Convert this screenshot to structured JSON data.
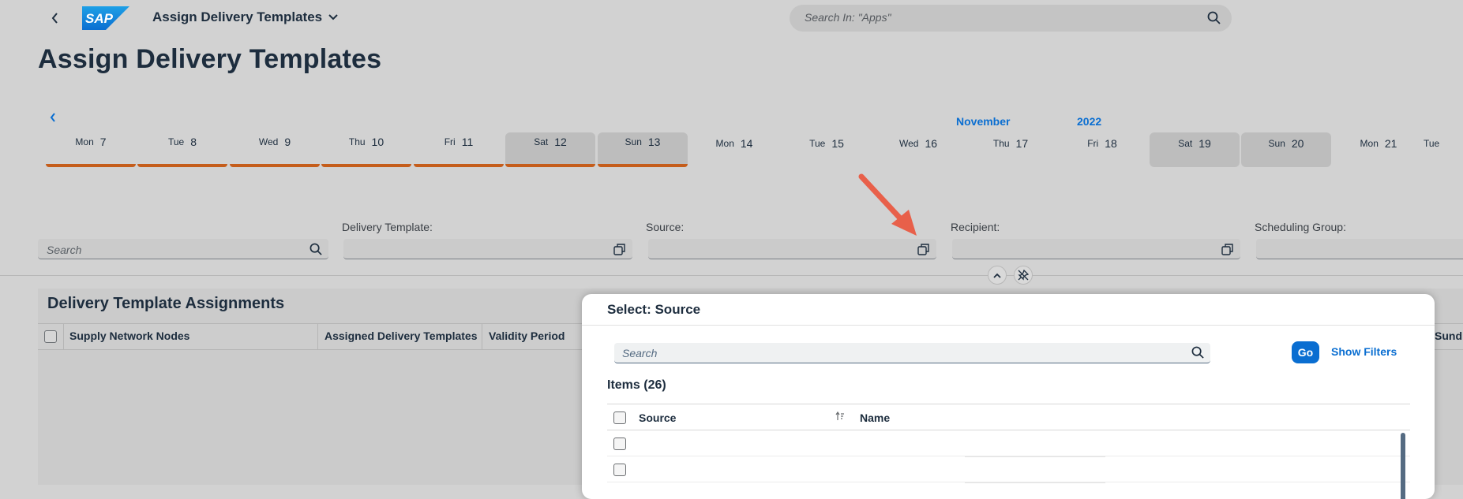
{
  "shell": {
    "app_title": "Assign Delivery Templates",
    "search_placeholder": "Search In: \"Apps\"",
    "logo_text": "SAP"
  },
  "page_title": "Assign Delivery Templates",
  "calendar": {
    "month": "November",
    "year": "2022",
    "days": [
      {
        "name": "Mon",
        "num": "7"
      },
      {
        "name": "Tue",
        "num": "8"
      },
      {
        "name": "Wed",
        "num": "9"
      },
      {
        "name": "Thu",
        "num": "10"
      },
      {
        "name": "Fri",
        "num": "11"
      },
      {
        "name": "Sat",
        "num": "12"
      },
      {
        "name": "Sun",
        "num": "13"
      },
      {
        "name": "Mon",
        "num": "14"
      },
      {
        "name": "Tue",
        "num": "15"
      },
      {
        "name": "Wed",
        "num": "16"
      },
      {
        "name": "Thu",
        "num": "17"
      },
      {
        "name": "Fri",
        "num": "18"
      },
      {
        "name": "Sat",
        "num": "19"
      },
      {
        "name": "Sun",
        "num": "20"
      },
      {
        "name": "Mon",
        "num": "21"
      },
      {
        "name": "Tue",
        "num": ""
      }
    ]
  },
  "filters": {
    "search_placeholder": "Search",
    "delivery_template_label": "Delivery Template:",
    "source_label": "Source:",
    "recipient_label": "Recipient:",
    "scheduling_group_label": "Scheduling Group:"
  },
  "table": {
    "title": "Delivery Template Assignments",
    "columns": [
      "Supply Network Nodes",
      "Assigned Delivery Templates",
      "Validity Period",
      "Sund"
    ]
  },
  "dialog": {
    "title": "Select: Source",
    "search_placeholder": "Search",
    "go_label": "Go",
    "show_filters_label": "Show Filters",
    "items_count": "Items (26)",
    "columns": [
      "Source",
      "Name"
    ]
  },
  "colors": {
    "accent": "#0a6ed1",
    "marker": "#c55d1b",
    "arrow": "#e8604a"
  }
}
